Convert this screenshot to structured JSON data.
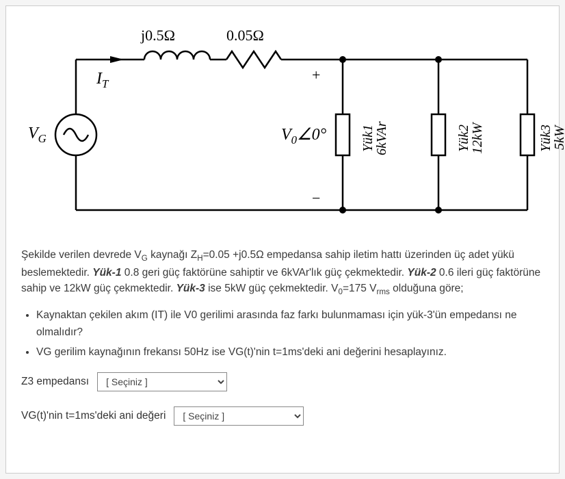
{
  "circuit": {
    "inductor_label": "j0.5Ω",
    "resistor_label": "0.05Ω",
    "current_label": "I",
    "current_sub": "T",
    "source_label": "V",
    "source_sub": "G",
    "node_voltage": "V",
    "node_voltage_sub": "0",
    "node_voltage_angle": "∠0°",
    "plus": "+",
    "minus": "−",
    "load1_name": "Yük1",
    "load1_power": "6kVAr",
    "load2_name": "Yük2",
    "load2_power": "12kW",
    "load3_name": "Yük3",
    "load3_power": "5kW"
  },
  "problem": {
    "p1": "Şekilde verilen devrede V",
    "p1_sub": "G",
    "p2": " kaynağı  Z",
    "p2_sub": "H",
    "p3": "=0.05 +j0.5Ω empedansa sahip iletim hattı üzerinden üç adet yükü beslemektedir. ",
    "yuk1_bold": "Yük-1",
    "yuk1_rest": " 0.8 geri güç faktörüne sahiptir ve 6kVAr'lık güç çekmektedir. ",
    "yuk2_bold": "Yük-2",
    "yuk2_rest": " 0.6 ileri güç faktörüne sahip ve 12kW güç çekmektedir. ",
    "yuk3_bold": "Yük-3",
    "yuk3_rest": " ise 5kW güç çekmektedir. V",
    "v0_sub": "0",
    "v0_rest": "=175 V",
    "vrms_sub": "rms",
    "vrms_rest": " olduğuna göre;"
  },
  "bullets": {
    "b1a": "Kaynaktan çekilen akım (I",
    "b1a_sub": "T",
    "b1b": ") ile V",
    "b1b_sub": "0",
    "b1c": " gerilimi arasında faz farkı bulunmaması için yük-3'ün empedansı ne olmalıdır?",
    "b2a": "V",
    "b2a_sub": "G",
    "b2b": " gerilim kaynağının frekansı  50Hz ise V",
    "b2b_sub": "G",
    "b2c": "(t)'nin t=1ms'deki ani değerini hesaplayınız."
  },
  "answers": {
    "q1_label_a": "Z",
    "q1_label_sub": "3",
    "q1_label_b": " empedansı",
    "q2_label_a": "V",
    "q2_label_sub": "G",
    "q2_label_b": "(t)'nin t=1ms'deki ani değeri",
    "select_placeholder": "[ Seçiniz ]"
  }
}
